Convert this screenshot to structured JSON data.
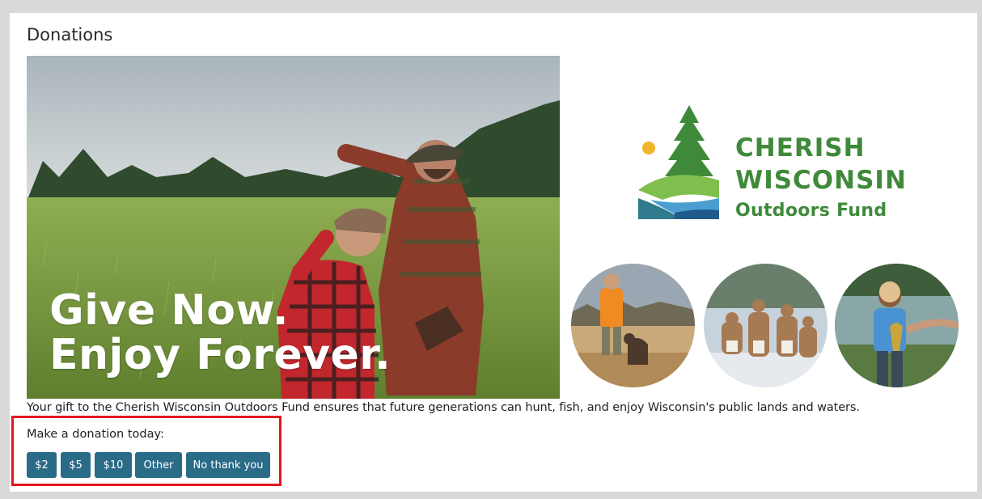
{
  "section_title": "Donations",
  "hero": {
    "line1": "Give Now.",
    "line2": "Enjoy Forever."
  },
  "logo": {
    "line1": "CHERISH",
    "line2": "WISCONSIN",
    "line3": "Outdoors Fund",
    "colors": {
      "green": "#3f8a3a",
      "blue": "#2a6b88",
      "sun": "#f0b428"
    }
  },
  "photos": [
    {
      "icon": "hunter-with-dog-photo"
    },
    {
      "icon": "deer-herd-photo"
    },
    {
      "icon": "child-fishing-photo"
    }
  ],
  "description": "Your gift to the Cherish Wisconsin Outdoors Fund ensures that future generations can hunt, fish, and enjoy Wisconsin's public lands and waters.",
  "donation": {
    "prompt": "Make a donation today:",
    "buttons": [
      "$2",
      "$5",
      "$10",
      "Other",
      "No thank you"
    ]
  },
  "colors": {
    "button": "#2a6b88",
    "highlight_border": "#e3171f",
    "background": "#d9d9d9"
  }
}
